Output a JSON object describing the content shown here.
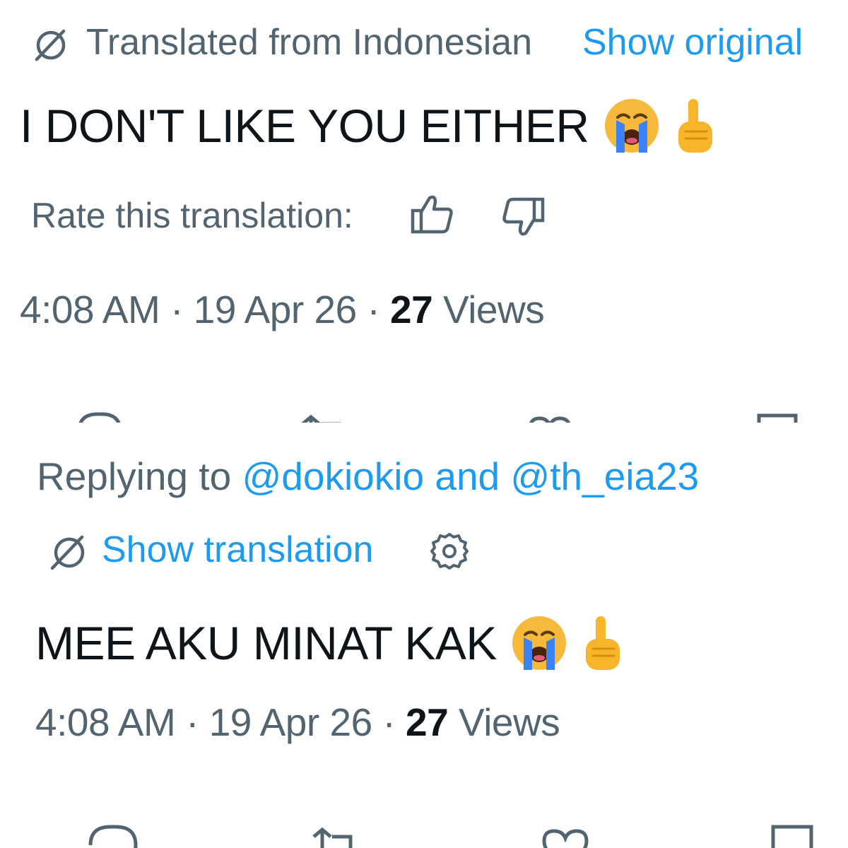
{
  "tweet1": {
    "translated_label": "Translated from Indonesian",
    "show_original": "Show original",
    "text": "I DON'T LIKE YOU EITHER",
    "emojis": [
      "loudly-crying-face",
      "index-pointing-up"
    ],
    "rate_label": "Rate this translation:",
    "time": "4:08 AM",
    "sep1": "·",
    "date": "19 Apr 26",
    "sep2": "·",
    "views_count": "27",
    "views_label": "Views",
    "icons": {
      "translate": "translate-icon",
      "thumbs_up": "thumbs-up-icon",
      "thumbs_down": "thumbs-down-icon",
      "reply": "reply-icon",
      "retweet": "retweet-icon",
      "like": "heart-icon",
      "bookmark": "bookmark-icon"
    }
  },
  "tweet2": {
    "replying_prefix": "Replying to",
    "mention1": "@dokiokio",
    "and_text": "and",
    "mention2": "@th_eia23",
    "show_translation": "Show translation",
    "text": "MEE AKU MINAT KAK",
    "emojis": [
      "loudly-crying-face",
      "index-pointing-up"
    ],
    "time": "4:08 AM",
    "sep1": "·",
    "date": "19 Apr 26",
    "sep2": "·",
    "views_count": "27",
    "views_label": "Views",
    "icons": {
      "translate": "translate-icon",
      "settings": "gear-icon",
      "reply": "reply-icon",
      "retweet": "retweet-icon",
      "like": "heart-icon",
      "bookmark": "bookmark-icon"
    }
  },
  "colors": {
    "text_primary": "#0f1419",
    "text_secondary": "#536471",
    "link": "#1d9bf0",
    "background": "#ffffff",
    "emoji_face": "#f6b93b",
    "emoji_tears": "#3b82f6"
  }
}
